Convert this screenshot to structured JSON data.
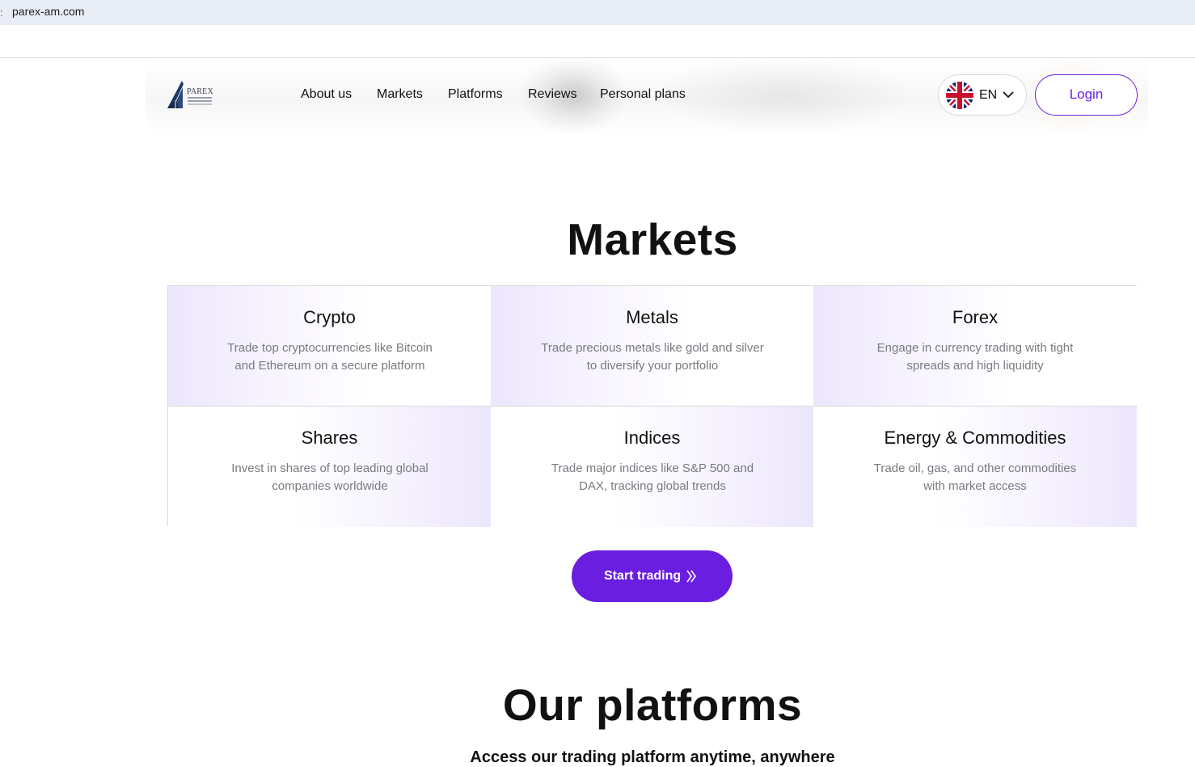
{
  "browser": {
    "url": "parex-am.com"
  },
  "header": {
    "logo": {
      "wordmark": "PAREX"
    },
    "nav": [
      "About us",
      "Markets",
      "Platforms",
      "Reviews",
      "Personal plans"
    ],
    "language": {
      "code": "EN",
      "flag_icon": "uk-flag-icon"
    },
    "login_label": "Login"
  },
  "markets": {
    "title": "Markets",
    "items": [
      {
        "title": "Crypto",
        "description": "Trade top cryptocurrencies like Bitcoin and Ethereum on a secure platform"
      },
      {
        "title": "Metals",
        "description": "Trade precious metals like gold and silver to diversify your portfolio"
      },
      {
        "title": "Forex",
        "description": "Engage in currency trading with tight spreads and high liquidity"
      },
      {
        "title": "Shares",
        "description": "Invest in shares of top leading global companies worldwide"
      },
      {
        "title": "Indices",
        "description": "Trade major indices like S&P 500 and DAX, tracking global trends"
      },
      {
        "title": "Energy & Commodities",
        "description": "Trade oil, gas, and other commodities with market access"
      }
    ],
    "cta_label": "Start trading",
    "cta_icon": "double-chevron-right-icon"
  },
  "platforms": {
    "title": "Our platforms",
    "subtitle": "Access our trading platform anytime, anywhere"
  },
  "colors": {
    "accent": "#6a1fe0",
    "card_tint": "#ece6fc",
    "text_muted": "#7a7a80"
  }
}
